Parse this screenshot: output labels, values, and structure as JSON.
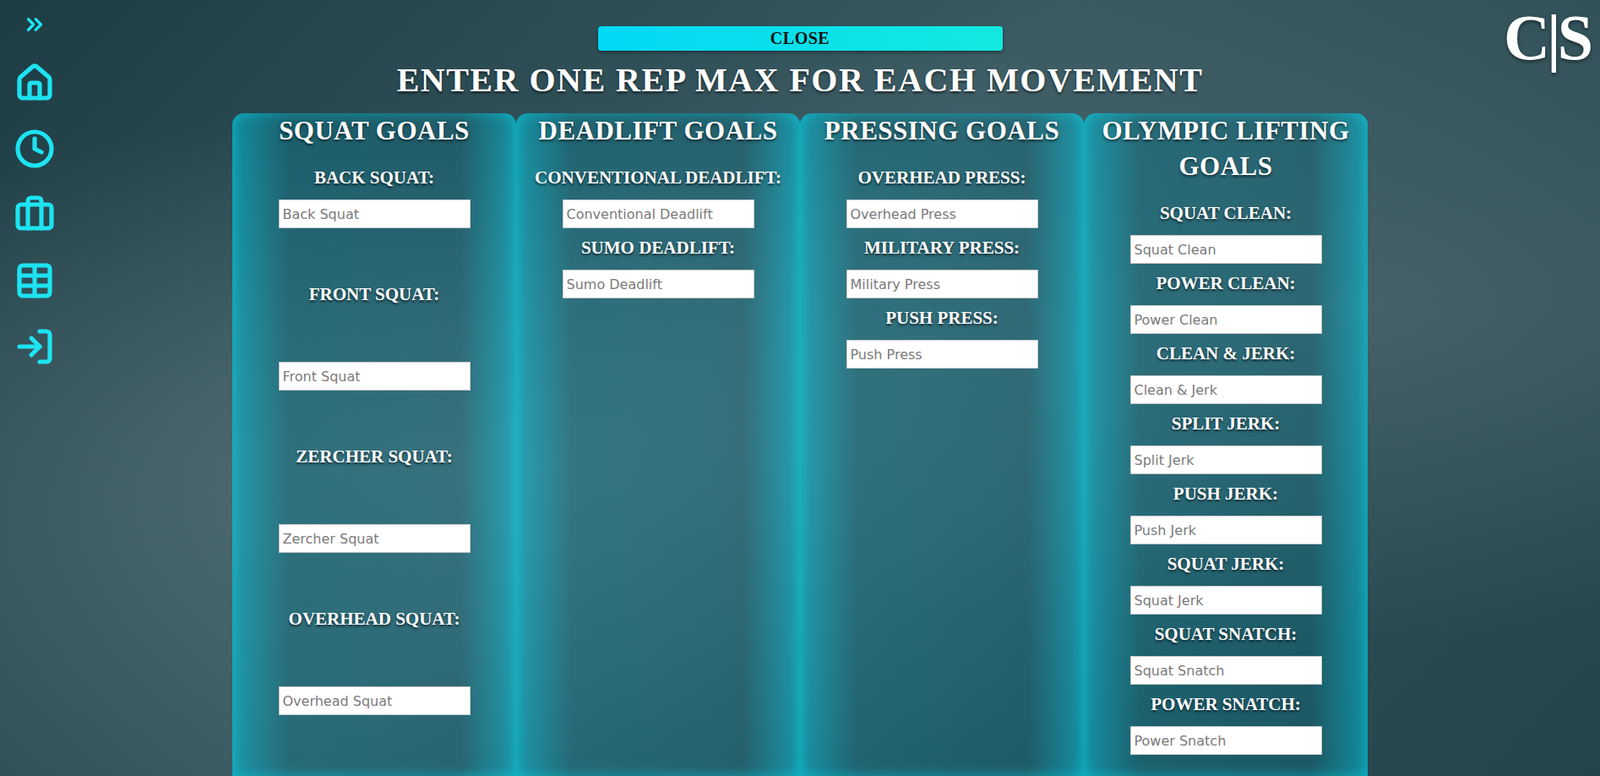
{
  "close_button": {
    "label": "CLOSE"
  },
  "title": "ENTER ONE REP MAX FOR EACH MOVEMENT",
  "logo": "C|S",
  "columns": [
    {
      "title": "SQUAT GOALS",
      "fields": [
        {
          "label": "BACK SQUAT:",
          "placeholder": "Back Squat"
        },
        {
          "label": "FRONT SQUAT:",
          "placeholder": "Front Squat"
        },
        {
          "label": "ZERCHER SQUAT:",
          "placeholder": "Zercher Squat"
        },
        {
          "label": "OVERHEAD SQUAT:",
          "placeholder": "Overhead Squat"
        }
      ]
    },
    {
      "title": "DEADLIFT GOALS",
      "fields": [
        {
          "label": "CONVENTIONAL DEADLIFT:",
          "placeholder": "Conventional Deadlift"
        },
        {
          "label": "SUMO DEADLIFT:",
          "placeholder": "Sumo Deadlift"
        }
      ]
    },
    {
      "title": "PRESSING GOALS",
      "fields": [
        {
          "label": "OVERHEAD PRESS:",
          "placeholder": "Overhead Press"
        },
        {
          "label": "MILITARY PRESS:",
          "placeholder": "Military Press"
        },
        {
          "label": "PUSH PRESS:",
          "placeholder": "Push Press"
        }
      ]
    },
    {
      "title": "OLYMPIC LIFTING GOALS",
      "fields": [
        {
          "label": "SQUAT CLEAN:",
          "placeholder": "Squat Clean"
        },
        {
          "label": "POWER CLEAN:",
          "placeholder": "Power Clean"
        },
        {
          "label": "CLEAN & JERK:",
          "placeholder": "Clean & Jerk"
        },
        {
          "label": "SPLIT JERK:",
          "placeholder": "Split Jerk"
        },
        {
          "label": "PUSH JERK:",
          "placeholder": "Push Jerk"
        },
        {
          "label": "SQUAT JERK:",
          "placeholder": "Squat Jerk"
        },
        {
          "label": "SQUAT SNATCH:",
          "placeholder": "Squat Snatch"
        },
        {
          "label": "POWER SNATCH:",
          "placeholder": "Power Snatch"
        }
      ]
    }
  ]
}
